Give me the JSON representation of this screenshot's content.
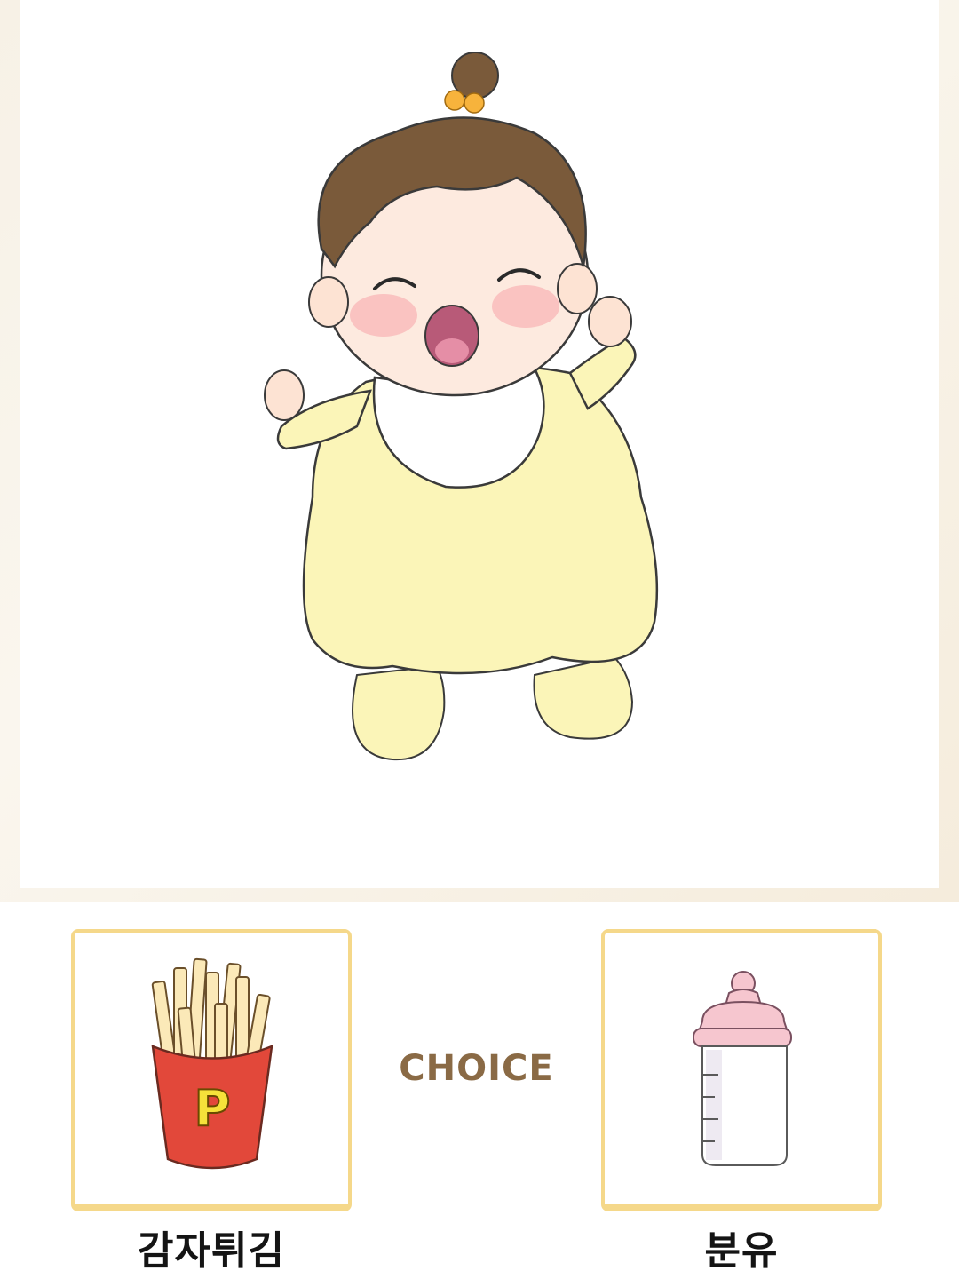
{
  "scene": {
    "character": "baby-icon"
  },
  "choices": [
    {
      "label": "감자튀김",
      "icon": "french-fries-icon",
      "badge_letter": "P"
    },
    {
      "label": "분유",
      "icon": "baby-bottle-icon"
    }
  ],
  "center_text": "CHOICE",
  "colors": {
    "card_border": "#f5d88a",
    "choice_text": "#8a6a45",
    "onesie": "#fbf5b8",
    "hair": "#7a5a3a",
    "fries_box": "#e2483a",
    "bottle_cap": "#f6c6cf"
  }
}
